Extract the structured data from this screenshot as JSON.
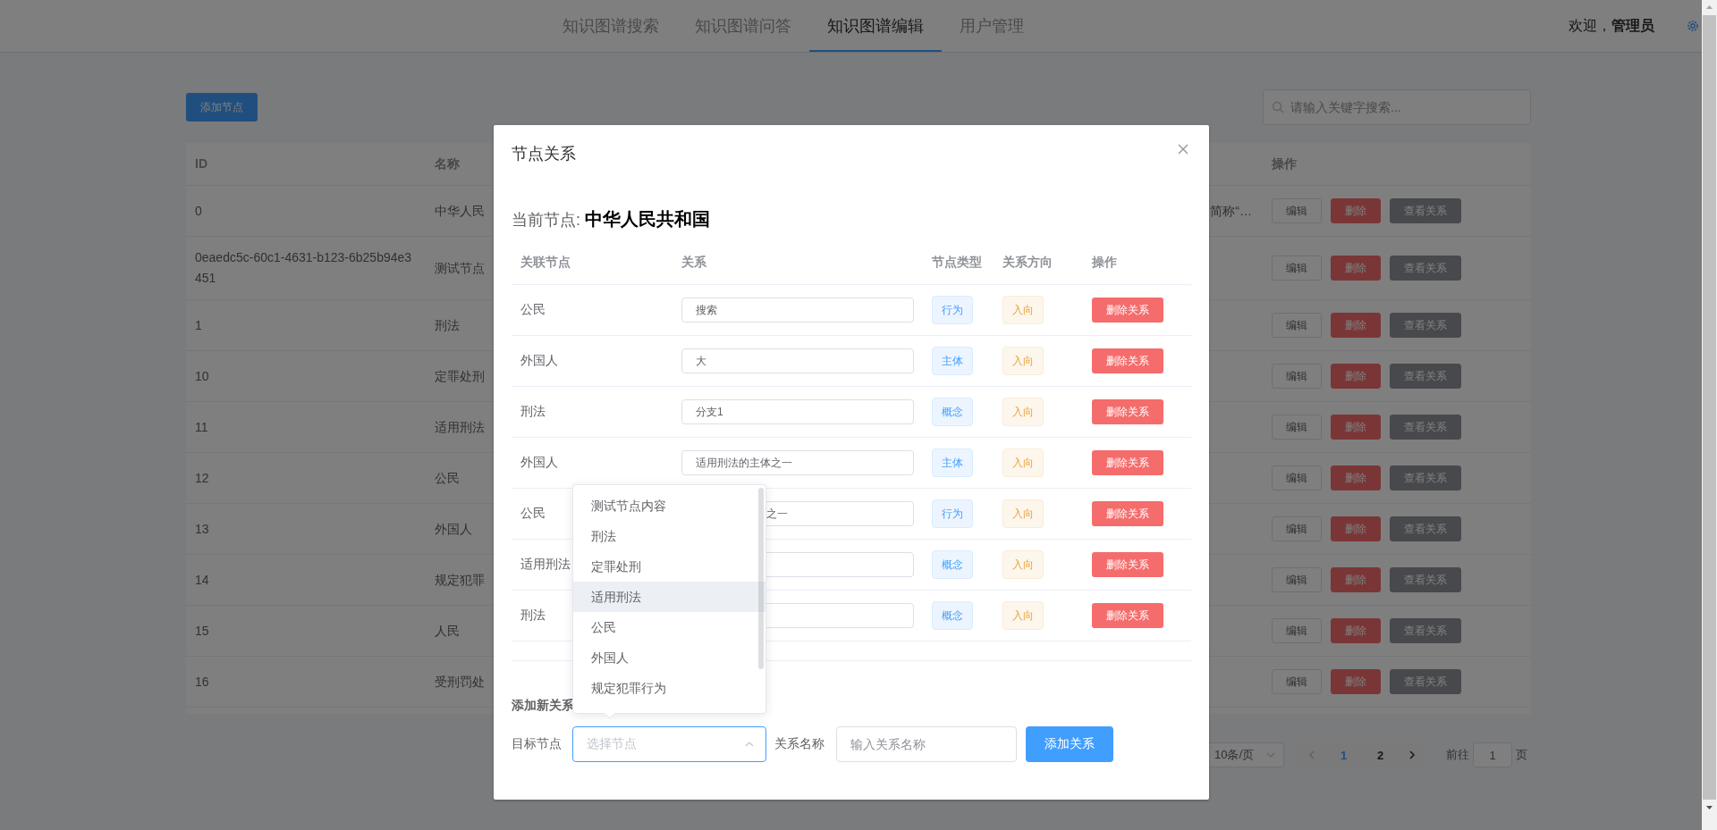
{
  "nav": {
    "tabs": [
      {
        "label": "知识图谱搜索",
        "selected": false
      },
      {
        "label": "知识图谱问答",
        "selected": false
      },
      {
        "label": "知识图谱编辑",
        "selected": true
      },
      {
        "label": "用户管理",
        "selected": false
      }
    ],
    "welcome": "欢迎，**管理员**"
  },
  "toolbar": {
    "add_button": "添加节点",
    "search_placeholder": "请输入关键字搜索..."
  },
  "table": {
    "columns": [
      "ID",
      "名称",
      "操作"
    ],
    "rows": [
      {
        "id": "0",
        "name": "中华人民",
        "column_3": "简称“…",
        "actions": [
          {
            "label": "编辑",
            "kind": "default"
          },
          {
            "label": "删除",
            "kind": "danger"
          },
          {
            "label": "查看关系",
            "kind": "info"
          }
        ]
      },
      {
        "id": "0eaedc5c-60c1-4631-b123-6b25b94e3451",
        "name": "测试节点",
        "actions": [
          {
            "label": "编辑",
            "kind": "default"
          },
          {
            "label": "删除",
            "kind": "danger"
          },
          {
            "label": "查看关系",
            "kind": "info"
          }
        ]
      },
      {
        "id": "1",
        "name": "刑法",
        "actions": [
          {
            "label": "编辑",
            "kind": "default"
          },
          {
            "label": "删除",
            "kind": "danger"
          },
          {
            "label": "查看关系",
            "kind": "info"
          }
        ]
      },
      {
        "id": "10",
        "name": "定罪处刑",
        "actions": [
          {
            "label": "编辑",
            "kind": "default"
          },
          {
            "label": "删除",
            "kind": "danger"
          },
          {
            "label": "查看关系",
            "kind": "info"
          }
        ]
      },
      {
        "id": "11",
        "name": "适用刑法",
        "actions": [
          {
            "label": "编辑",
            "kind": "default"
          },
          {
            "label": "删除",
            "kind": "danger"
          },
          {
            "label": "查看关系",
            "kind": "info"
          }
        ]
      },
      {
        "id": "12",
        "name": "公民",
        "actions": [
          {
            "label": "编辑",
            "kind": "default"
          },
          {
            "label": "删除",
            "kind": "danger"
          },
          {
            "label": "查看关系",
            "kind": "info"
          }
        ]
      },
      {
        "id": "13",
        "name": "外国人",
        "actions": [
          {
            "label": "编辑",
            "kind": "default"
          },
          {
            "label": "删除",
            "kind": "danger"
          },
          {
            "label": "查看关系",
            "kind": "info"
          }
        ]
      },
      {
        "id": "14",
        "name": "规定犯罪",
        "actions": [
          {
            "label": "编辑",
            "kind": "default"
          },
          {
            "label": "删除",
            "kind": "danger"
          },
          {
            "label": "查看关系",
            "kind": "info"
          }
        ]
      },
      {
        "id": "15",
        "name": "人民",
        "actions": [
          {
            "label": "编辑",
            "kind": "default"
          },
          {
            "label": "删除",
            "kind": "danger"
          },
          {
            "label": "查看关系",
            "kind": "info"
          }
        ]
      },
      {
        "id": "16",
        "name": "受刑罚处",
        "actions": [
          {
            "label": "编辑",
            "kind": "default"
          },
          {
            "label": "删除",
            "kind": "danger"
          },
          {
            "label": "查看关系",
            "kind": "info"
          }
        ]
      }
    ]
  },
  "pagination": {
    "page_size": "10条/页",
    "pages": [
      {
        "label": "1",
        "selected": true
      },
      {
        "label": "2",
        "selected": false
      }
    ],
    "goto_label": "前往",
    "goto_value": "1",
    "goto_suffix": "页"
  },
  "dialog": {
    "title": "节点关系",
    "current": "当前节点: **中华人民共和国**",
    "columns": [
      "关联节点",
      "关系",
      "节点类型",
      "关系方向",
      "操作"
    ],
    "rows": [
      {
        "node": "公民",
        "relation": "搜索",
        "covered": false,
        "type": "行为",
        "direction": "入向",
        "action": "删除关系"
      },
      {
        "node": "外国人",
        "relation": "大",
        "covered": false,
        "type": "主体",
        "direction": "入向",
        "action": "删除关系"
      },
      {
        "node": "刑法",
        "relation": "分支1",
        "covered": false,
        "type": "概念",
        "direction": "入向",
        "action": "删除关系"
      },
      {
        "node": "外国人",
        "relation": "适用刑法的主体之一",
        "covered": false,
        "type": "主体",
        "direction": "入向",
        "action": "删除关系"
      },
      {
        "node": "公民",
        "relation": "之一",
        "covered": true,
        "type": "行为",
        "direction": "入向",
        "action": "删除关系"
      },
      {
        "node": "适用刑法",
        "covered": true,
        "type": "概念",
        "direction": "入向",
        "action": "删除关系"
      },
      {
        "node": "刑法",
        "covered": true,
        "type": "概念",
        "direction": "入向",
        "action": "删除关系"
      }
    ],
    "add_section": {
      "title": "添加新关系",
      "target_label": "目标节点",
      "target_placeholder": "选择节点",
      "target_open": true,
      "name_label": "关系名称",
      "name_placeholder": "输入关系名称",
      "button": "添加关系"
    },
    "dropdown": {
      "options": [
        {
          "label": "测试节点内容",
          "hovered": false
        },
        {
          "label": "刑法",
          "hovered": false
        },
        {
          "label": "定罪处刑",
          "hovered": false
        },
        {
          "label": "适用刑法",
          "hovered": true
        },
        {
          "label": "公民",
          "hovered": false
        },
        {
          "label": "外国人",
          "hovered": false
        },
        {
          "label": "规定犯罪行为",
          "hovered": false
        }
      ]
    }
  }
}
